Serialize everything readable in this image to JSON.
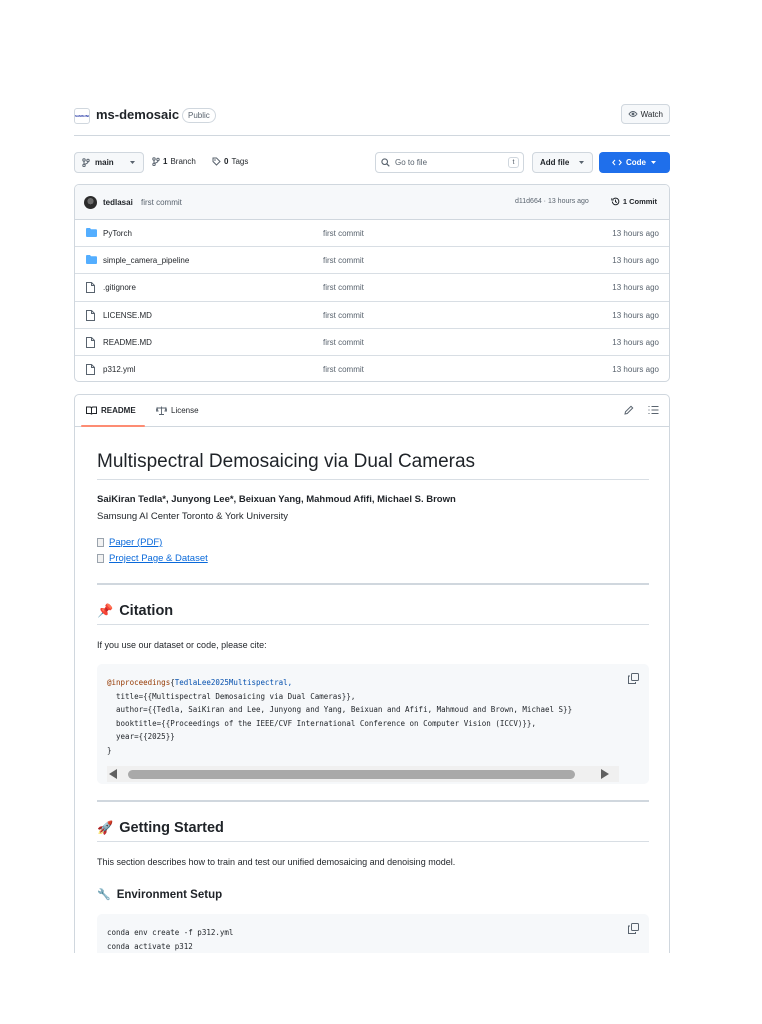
{
  "repo": {
    "logo_text": "SAMSUNG",
    "name": "ms-demosaic",
    "visibility": "Public",
    "watch_label": "Watch"
  },
  "toolbar": {
    "branch": "main",
    "branches_count": "1",
    "branches_label": "Branch",
    "tags_count": "0",
    "tags_label": "Tags",
    "search_placeholder": "Go to file",
    "search_key": "t",
    "add_file": "Add file",
    "code": "Code"
  },
  "latest_commit": {
    "author": "tedlasai",
    "message": "first commit",
    "meta": "d11d664 · 13 hours ago",
    "commit_count": "1 Commit"
  },
  "files": [
    {
      "name": "PyTorch",
      "type": "folder",
      "message": "first commit",
      "time": "13 hours ago"
    },
    {
      "name": "simple_camera_pipeline",
      "type": "folder",
      "message": "first commit",
      "time": "13 hours ago"
    },
    {
      "name": ".gitignore",
      "type": "file",
      "message": "first commit",
      "time": "13 hours ago"
    },
    {
      "name": "LICENSE.MD",
      "type": "file",
      "message": "first commit",
      "time": "13 hours ago"
    },
    {
      "name": "README.MD",
      "type": "file",
      "message": "first commit",
      "time": "13 hours ago"
    },
    {
      "name": "p312.yml",
      "type": "file",
      "message": "first commit",
      "time": "13 hours ago"
    }
  ],
  "readme_tabs": {
    "readme": "README",
    "license": "License"
  },
  "readme": {
    "title": "Multispectral Demosaicing via Dual Cameras",
    "authors": "SaiKiran Tedla*, Junyong Lee*, Beixuan Yang, Mahmoud Afifi, Michael S. Brown",
    "affiliation": "Samsung AI Center Toronto & York University",
    "links": [
      "Paper (PDF)",
      "Project Page & Dataset"
    ],
    "citation_heading": "Citation",
    "citation_intro": "If you use our dataset or code, please cite:",
    "bibtex": {
      "entry_type": "@inproceedings",
      "key": "TedlaLee2025Multispectral,",
      "title_line": "  title={{Multispectral Demosaicing via Dual Cameras}},",
      "author_line": "  author={{Tedla, SaiKiran and Lee, Junyong and Yang, Beixuan and Afifi, Mahmoud and Brown, Michael S}}",
      "booktitle_line": "  booktitle={{Proceedings of the IEEE/CVF International Conference on Computer Vision (ICCV)}},",
      "year_line": "  year={{2025}}",
      "close": "}"
    },
    "getting_started_heading": "Getting Started",
    "getting_started_text": "This section describes how to train and test our unified demosaicing and denoising model.",
    "env_setup_heading": "Environment Setup",
    "env_code": [
      "conda env create -f p312.yml",
      "conda activate p312"
    ]
  },
  "colors": {
    "accent_blue": "#1f6feb",
    "link_blue": "#0969da",
    "folder_blue": "#54aeff",
    "tab_underline": "#fd8c73"
  }
}
